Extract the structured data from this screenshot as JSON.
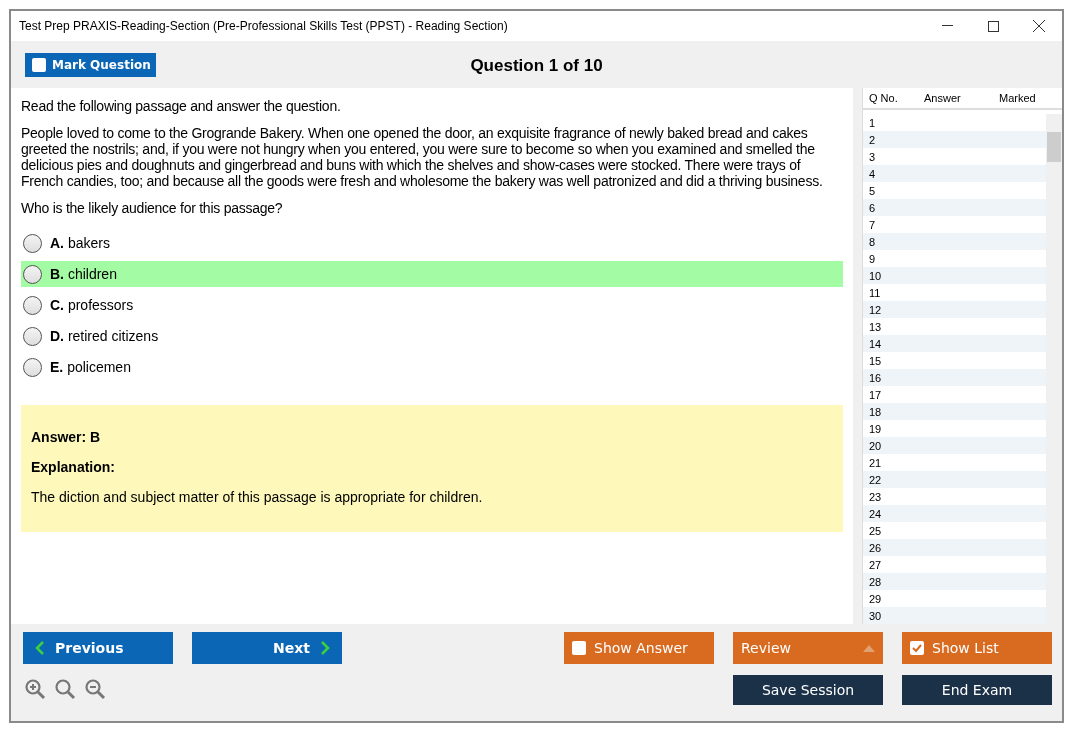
{
  "window": {
    "title": "Test Prep PRAXIS-Reading-Section (Pre-Professional Skills Test (PPST) - Reading Section)"
  },
  "toolbar": {
    "mark_question": {
      "label": "Mark Question",
      "checked": false
    },
    "heading": "Question 1 of 10"
  },
  "question": {
    "instruction": "Read the following passage and answer the question.",
    "passage": "People loved to come to the Grogrande Bakery. When one opened the door, an exquisite fragrance of newly baked bread and cakes greeted the nostrils; and, if you were not hungry when you entered, you were sure to become so when you examined and smelled the delicious pies and doughnuts and gingerbread and buns with which the shelves and show-cases were stocked. There were trays of French candies, too; and because all the goods were fresh and wholesome the bakery was well patronized and did a thriving business.",
    "prompt": "Who is the likely audience for this passage?",
    "options": [
      {
        "letter": "A.",
        "text": "bakers",
        "selected": false
      },
      {
        "letter": "B.",
        "text": "children",
        "selected": true
      },
      {
        "letter": "C.",
        "text": "professors",
        "selected": false
      },
      {
        "letter": "D.",
        "text": "retired citizens",
        "selected": false
      },
      {
        "letter": "E.",
        "text": "policemen",
        "selected": false
      }
    ]
  },
  "answer_panel": {
    "answer": "Answer: B",
    "explanation_label": "Explanation:",
    "explanation": "The diction and subject matter of this passage is appropriate for children."
  },
  "question_list": {
    "columns": [
      "Q No.",
      "Answer",
      "Marked"
    ],
    "rows": [
      {
        "q_no": "1"
      },
      {
        "q_no": "2"
      },
      {
        "q_no": "3"
      },
      {
        "q_no": "4"
      },
      {
        "q_no": "5"
      },
      {
        "q_no": "6"
      },
      {
        "q_no": "7"
      },
      {
        "q_no": "8"
      },
      {
        "q_no": "9"
      },
      {
        "q_no": "10"
      },
      {
        "q_no": "11"
      },
      {
        "q_no": "12"
      },
      {
        "q_no": "13"
      },
      {
        "q_no": "14"
      },
      {
        "q_no": "15"
      },
      {
        "q_no": "16"
      },
      {
        "q_no": "17"
      },
      {
        "q_no": "18"
      },
      {
        "q_no": "19"
      },
      {
        "q_no": "20"
      },
      {
        "q_no": "21"
      },
      {
        "q_no": "22"
      },
      {
        "q_no": "23"
      },
      {
        "q_no": "24"
      },
      {
        "q_no": "25"
      },
      {
        "q_no": "26"
      },
      {
        "q_no": "27"
      },
      {
        "q_no": "28"
      },
      {
        "q_no": "29"
      },
      {
        "q_no": "30"
      }
    ]
  },
  "footer": {
    "previous": "Previous",
    "next": "Next",
    "show_answer": {
      "label": "Show Answer",
      "checked": false
    },
    "review": "Review",
    "show_list": {
      "label": "Show List",
      "checked": true
    },
    "save_session": "Save Session",
    "end_exam": "End Exam"
  }
}
